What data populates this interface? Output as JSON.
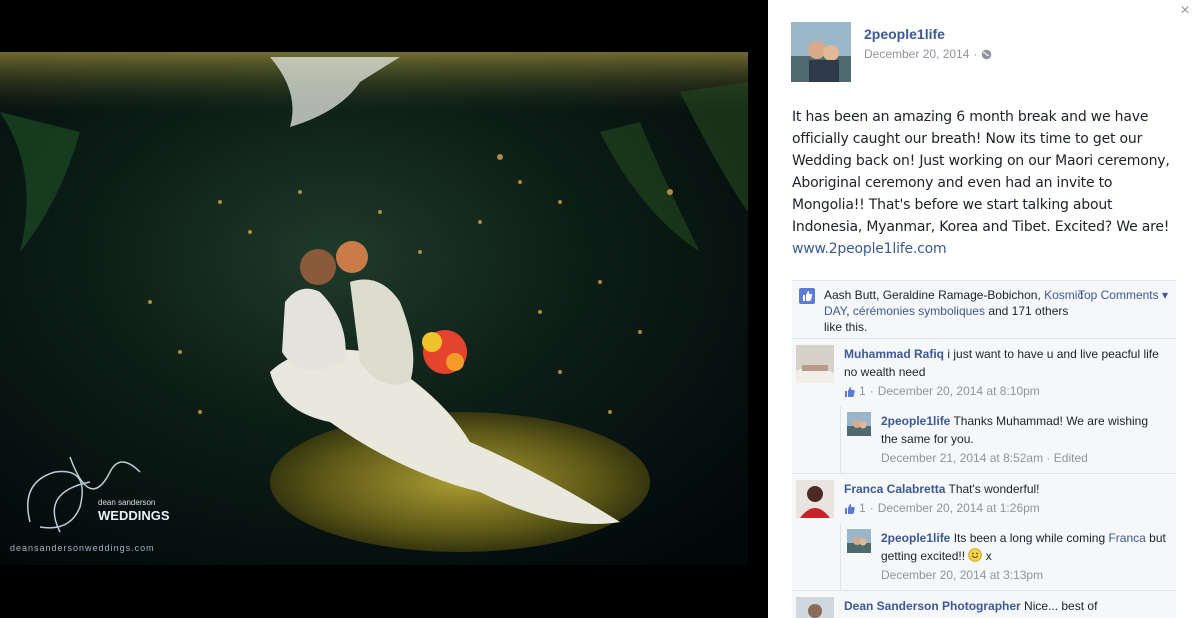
{
  "photo": {
    "watermark_brand_line1": "dean sanderson",
    "watermark_brand_line2": "WEDDINGS",
    "watermark_url": "deansandersonweddings.com",
    "watermark_monogram": "dsw"
  },
  "panel": {
    "close_label": "×",
    "author": "2people1life",
    "date": "December 20, 2014",
    "date_separator": "·",
    "post_text": "It has been an amazing 6 month break and we have officially caught our breath! Now its time to get our Wedding back on! Just working on our Maori ceremony, Aboriginal ceremony and even had an invite to Mongolia!! That's before we start talking about Indonesia, Myanmar, Korea and Tibet. Excited? We are! ",
    "post_link": "www.2people1life.com",
    "likes": {
      "names_plain": "Aash Butt, Geraldine Ramage-Bobichon, ",
      "link1": "Kosmic DAY",
      "comma": ", ",
      "link2": "cérémonies symboliques",
      "tail": " and 171 others like this.",
      "top_comments": "Top Comments ▾"
    },
    "comments": [
      {
        "name": "Muhammad Rafiq",
        "text": " i just want to have u and live peacful life no wealth need",
        "likes": "1",
        "sep": "·",
        "time": "December 20, 2014 at 8:10pm",
        "reply": {
          "name": "2people1life",
          "text": " Thanks Muhammad! We are wishing the same for you.",
          "time": "December 21, 2014 at 8:52am · Edited"
        }
      },
      {
        "name": "Franca Calabretta",
        "text": " That's wonderful!",
        "likes": "1",
        "sep": "·",
        "time": "December 20, 2014 at 1:26pm",
        "reply": {
          "name": "2people1life",
          "text": " Its been a long while coming ",
          "mention": "Franca",
          "text2": " but getting excited!! ",
          "text3": " x",
          "time": "December 20, 2014 at 3:13pm"
        }
      },
      {
        "name": "Dean Sanderson Photographer",
        "text": " Nice... best of"
      }
    ]
  },
  "colors": {
    "link": "#3b5998",
    "meta": "#90949c",
    "ufi_bg": "#f6f7f9"
  }
}
